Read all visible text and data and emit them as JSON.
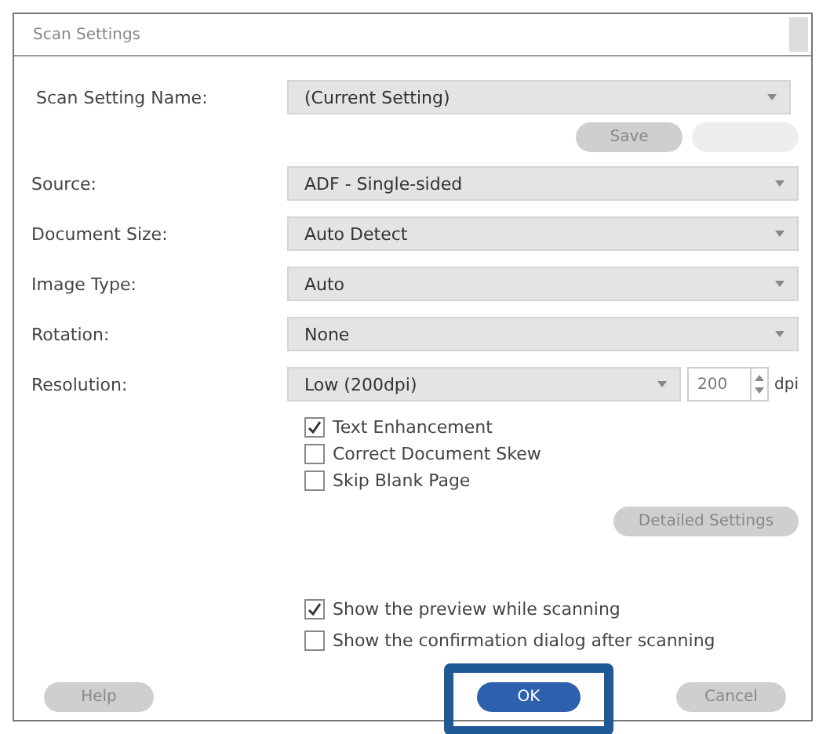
{
  "window": {
    "title": "Scan Settings"
  },
  "setting_name": {
    "label": "Scan Setting Name:",
    "value": "(Current Setting)"
  },
  "save_buttons": [
    {
      "label": "Save",
      "disabled": false
    },
    {
      "disabled": true
    }
  ],
  "fields": [
    {
      "label": "Source:",
      "value": "ADF - Single-sided"
    },
    {
      "label": "Document Size:",
      "value": "Auto Detect"
    },
    {
      "label": "Image Type:",
      "value": "Auto"
    },
    {
      "label": "Rotation:",
      "value": "None"
    }
  ],
  "resolution": {
    "label": "Resolution:",
    "value": "Low (200dpi)",
    "number": "200",
    "unit": "dpi"
  },
  "options": [
    {
      "label": "Text Enhancement",
      "checked": true
    },
    {
      "label": "Correct Document Skew",
      "checked": false
    },
    {
      "label": "Skip Blank Page",
      "checked": false
    }
  ],
  "detailed_button": "Detailed Settings",
  "preview_options": [
    {
      "label": "Show the preview while scanning",
      "checked": true
    },
    {
      "label": "Show the confirmation dialog after scanning",
      "checked": false
    }
  ],
  "buttons": [
    {
      "label": "Help",
      "kind": "plain"
    },
    {
      "label": "OK",
      "kind": "primary"
    },
    {
      "label": "Cancel",
      "kind": "plain"
    }
  ]
}
